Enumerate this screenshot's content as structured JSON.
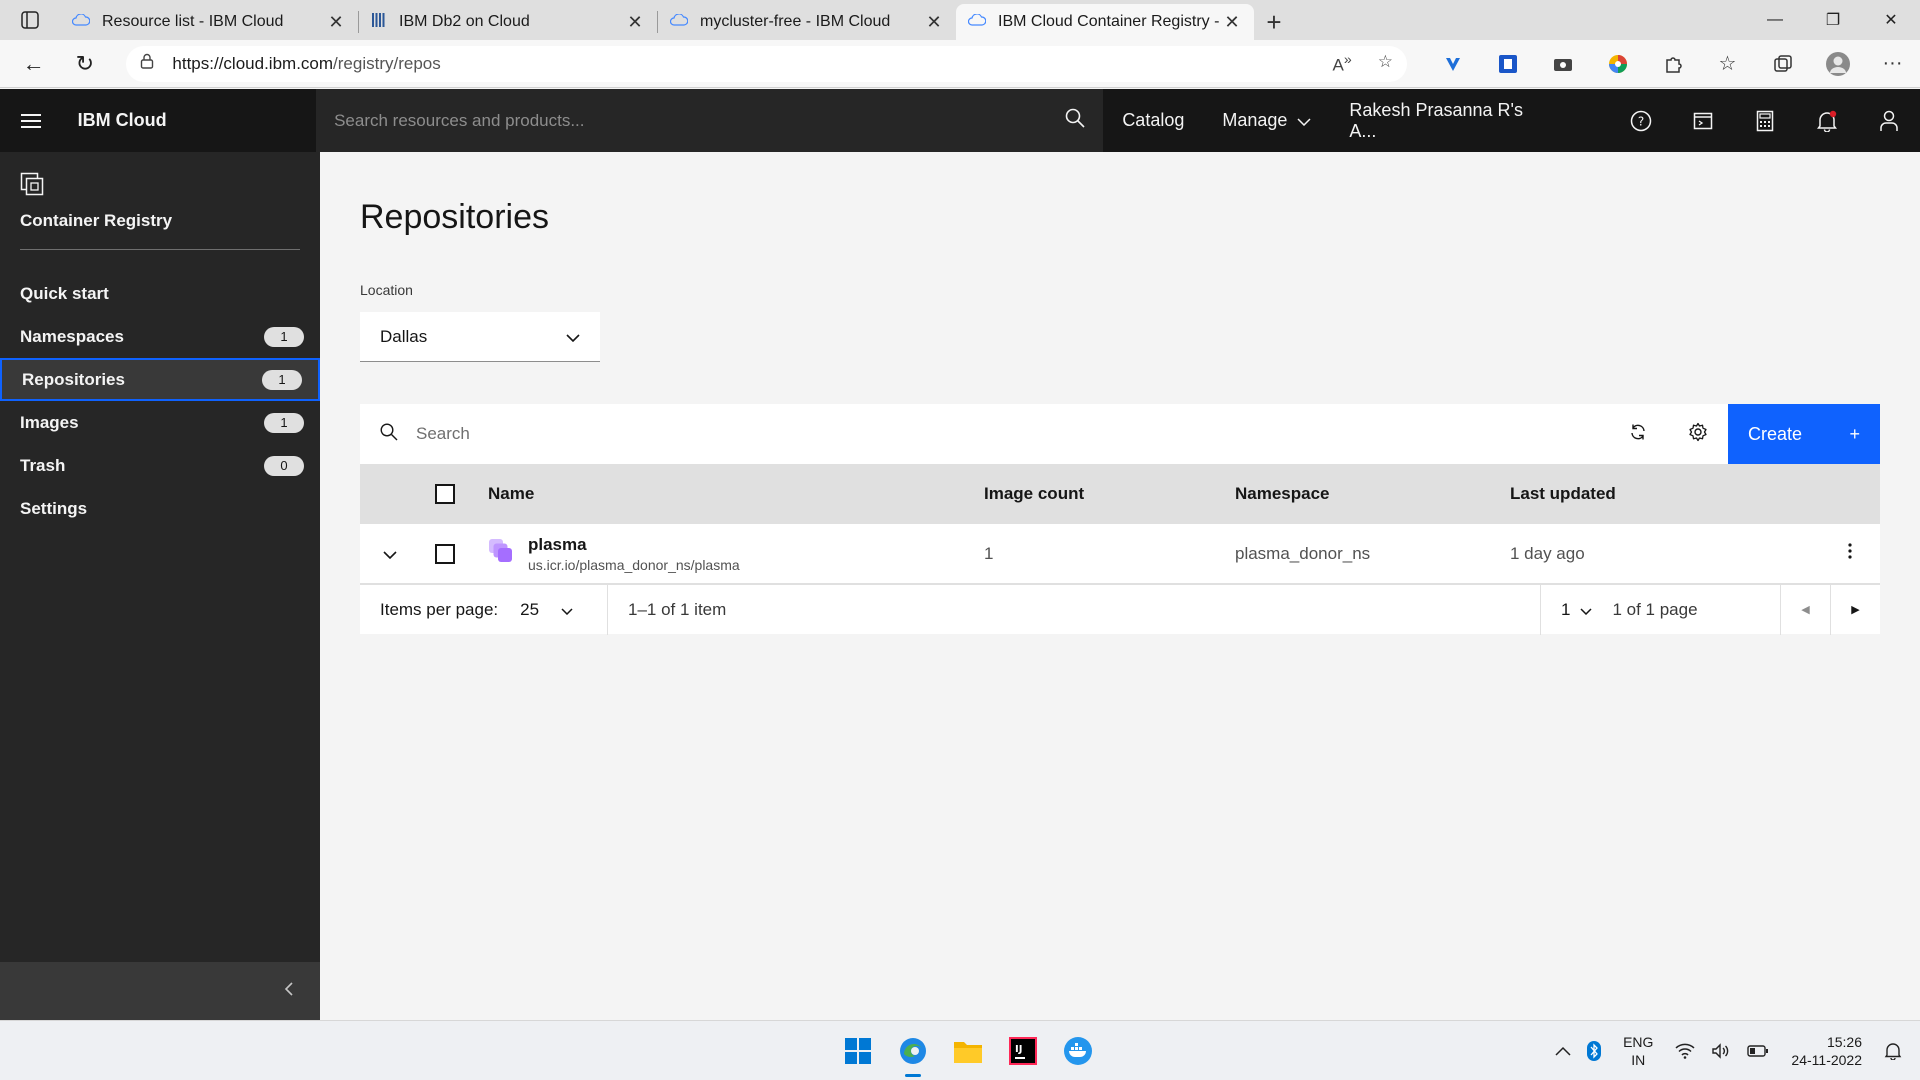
{
  "browser": {
    "tabs": [
      {
        "title": "Resource list - IBM Cloud",
        "icon": "cloud-icon",
        "active": false
      },
      {
        "title": "IBM Db2 on Cloud",
        "icon": "db2-icon",
        "active": false
      },
      {
        "title": "mycluster-free - IBM Cloud",
        "icon": "cloud-icon",
        "active": false
      },
      {
        "title": "IBM Cloud Container Registry - R",
        "icon": "cloud-icon",
        "active": true
      }
    ],
    "url_host": "https://cloud.ibm.com",
    "url_path": "/registry/repos"
  },
  "header": {
    "brand": "IBM Cloud",
    "search_placeholder": "Search resources and products...",
    "links": {
      "catalog": "Catalog",
      "manage": "Manage",
      "account": "Rakesh Prasanna R's A..."
    }
  },
  "sidebar": {
    "title": "Container Registry",
    "items": [
      {
        "label": "Quick start",
        "badge": null
      },
      {
        "label": "Namespaces",
        "badge": "1"
      },
      {
        "label": "Repositories",
        "badge": "1",
        "active": true
      },
      {
        "label": "Images",
        "badge": "1"
      },
      {
        "label": "Trash",
        "badge": "0"
      },
      {
        "label": "Settings",
        "badge": null
      }
    ]
  },
  "main": {
    "title": "Repositories",
    "location_label": "Location",
    "location_value": "Dallas",
    "search_placeholder": "Search",
    "create_label": "Create",
    "columns": {
      "name": "Name",
      "image_count": "Image count",
      "namespace": "Namespace",
      "last_updated": "Last updated"
    },
    "rows": [
      {
        "name": "plasma",
        "path": "us.icr.io/plasma_donor_ns/plasma",
        "image_count": "1",
        "namespace": "plasma_donor_ns",
        "last_updated": "1 day ago"
      }
    ],
    "pagination": {
      "items_per_page_label": "Items per page:",
      "items_per_page": "25",
      "range": "1–1 of 1 item",
      "page": "1",
      "of_pages": "1 of 1 page"
    }
  },
  "taskbar": {
    "lang1": "ENG",
    "lang2": "IN",
    "time": "15:26",
    "date": "24-11-2022"
  },
  "colors": {
    "accent": "#0f62fe",
    "header_bg": "#161616",
    "sidebar_bg": "#262626"
  }
}
